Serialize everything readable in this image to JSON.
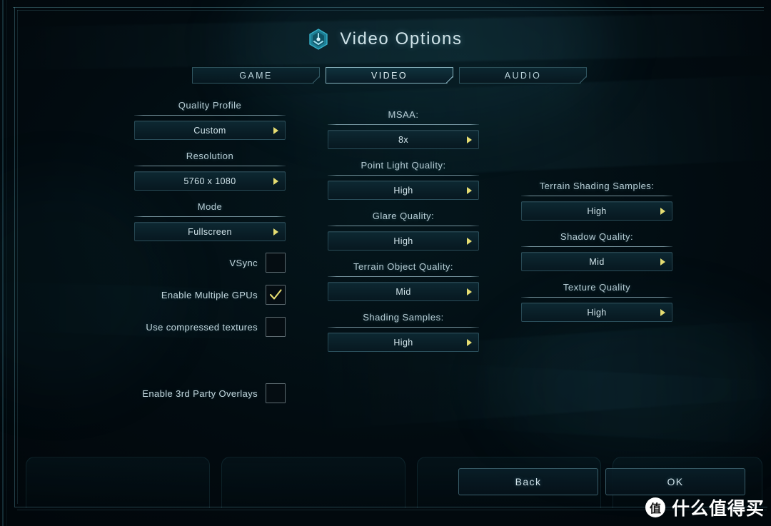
{
  "header": {
    "title": "Video Options",
    "icon": "hexagon-emblem-icon"
  },
  "tabs": [
    {
      "label": "GAME",
      "active": false
    },
    {
      "label": "VIDEO",
      "active": true
    },
    {
      "label": "AUDIO",
      "active": false
    }
  ],
  "columns": {
    "left": [
      {
        "label": "Quality Profile",
        "value": "Custom"
      },
      {
        "label": "Resolution",
        "value": "5760 x 1080"
      },
      {
        "label": "Mode",
        "value": "Fullscreen"
      }
    ],
    "middle": [
      {
        "label": "MSAA:",
        "value": "8x"
      },
      {
        "label": "Point Light Quality:",
        "value": "High"
      },
      {
        "label": "Glare Quality:",
        "value": "High"
      },
      {
        "label": "Terrain Object Quality:",
        "value": "Mid"
      },
      {
        "label": "Shading Samples:",
        "value": "High"
      }
    ],
    "right": [
      {
        "label": "Terrain Shading Samples:",
        "value": "High"
      },
      {
        "label": "Shadow Quality:",
        "value": "Mid"
      },
      {
        "label": "Texture Quality",
        "value": "High"
      }
    ]
  },
  "checkboxes": [
    {
      "label": "VSync",
      "checked": false
    },
    {
      "label": "Enable Multiple GPUs",
      "checked": true
    },
    {
      "label": "Use compressed textures",
      "checked": false
    },
    {
      "label": "Enable 3rd Party Overlays",
      "checked": false
    }
  ],
  "footer": {
    "back_label": "Back",
    "ok_label": "OK"
  },
  "watermark": {
    "logo_char": "值",
    "text": "什么值得买"
  },
  "colors": {
    "accent_arrow": "#e6dd72",
    "check_mark": "#e6dd72",
    "text_primary": "#d2e4ea",
    "panel_teal": "#0d2832",
    "border_teal": "#78b4c4"
  }
}
